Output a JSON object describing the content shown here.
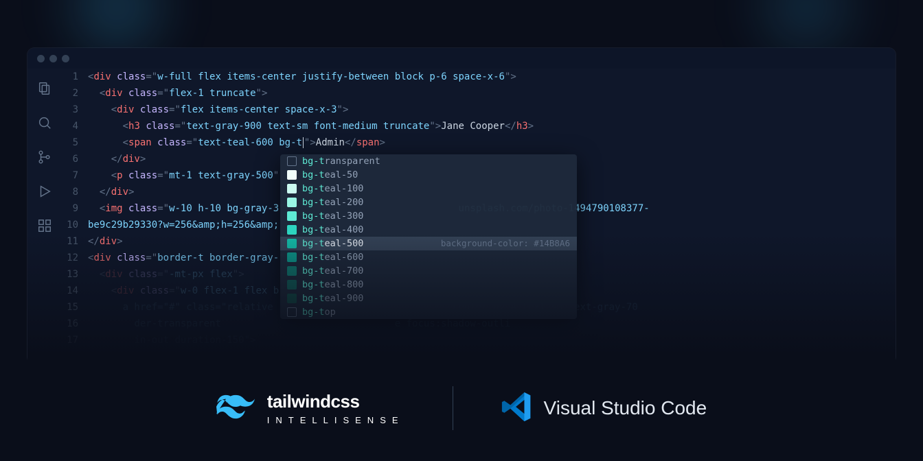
{
  "code": {
    "lines": [
      {
        "num": 1,
        "indent": 0,
        "tag": "div",
        "classAttr": "w-full flex items-center justify-between block p-6 space-x-6",
        "open": true
      },
      {
        "num": 2,
        "indent": 1,
        "tag": "div",
        "classAttr": "flex-1 truncate",
        "open": true
      },
      {
        "num": 3,
        "indent": 2,
        "tag": "div",
        "classAttr": "flex items-center space-x-3",
        "open": true
      },
      {
        "num": 4,
        "indent": 3,
        "tag": "h3",
        "classAttr": "text-gray-900 text-sm font-medium truncate",
        "content": "Jane Cooper",
        "close": "h3"
      },
      {
        "num": 5,
        "indent": 3,
        "tag": "span",
        "classAttr": "text-teal-600 bg-t",
        "cursor": true,
        "content": "Admin",
        "close": "span"
      },
      {
        "num": 6,
        "indent": 2,
        "closeTag": "div"
      },
      {
        "num": 7,
        "indent": 2,
        "tag": "p",
        "classAttr": "mt-1 text-gray-500",
        "open": true,
        "truncated": true
      },
      {
        "num": 8,
        "indent": 1,
        "closeTag": "div"
      },
      {
        "num": 9,
        "indent": 1,
        "tag": "img",
        "classAttr": "w-10 h-10 bg-gray-3",
        "truncated": true,
        "tail": "unsplash.com/photo-1494790108377-"
      },
      {
        "num": 10,
        "indent": 0,
        "raw": "be9c29b29330?w=256&amp;h=256&amp;"
      },
      {
        "num": 11,
        "indent": 0,
        "closeTag": "div"
      },
      {
        "num": 12,
        "indent": 0,
        "tag": "div",
        "classAttr": "border-t border-gray-",
        "open": true,
        "truncated": true
      },
      {
        "num": 13,
        "indent": 1,
        "tag": "div",
        "classAttr": "-mt-px flex",
        "open": true,
        "fade": 1
      },
      {
        "num": 14,
        "indent": 2,
        "tag": "div",
        "classAttr": "w-0 flex-1 flex b",
        "open": true,
        "truncated": true,
        "fade": 1
      },
      {
        "num": 15,
        "indent": 3,
        "fade": 2,
        "rawHtml": "a href=\"#\" class=\"relative",
        "tail": "-center py-4 text-sm text-gray-70"
      },
      {
        "num": 16,
        "indent": 4,
        "fade": 2,
        "rawHtml": "der-transparent",
        "tail": "e focus:shadow-outli"
      },
      {
        "num": 17,
        "indent": 4,
        "fade": 2,
        "rawHtml": "in-out duration-150\">"
      }
    ]
  },
  "autocomplete": {
    "items": [
      {
        "label": "bg-transparent",
        "match": "bg-t",
        "rest": "ransparent",
        "icon": "abc"
      },
      {
        "label": "bg-teal-50",
        "match": "bg-t",
        "rest": "eal-50",
        "swatch": "#f0fdfa"
      },
      {
        "label": "bg-teal-100",
        "match": "bg-t",
        "rest": "eal-100",
        "swatch": "#ccfbf1"
      },
      {
        "label": "bg-teal-200",
        "match": "bg-t",
        "rest": "eal-200",
        "swatch": "#99f6e4"
      },
      {
        "label": "bg-teal-300",
        "match": "bg-t",
        "rest": "eal-300",
        "swatch": "#5eead4"
      },
      {
        "label": "bg-teal-400",
        "match": "bg-t",
        "rest": "eal-400",
        "swatch": "#2dd4bf"
      },
      {
        "label": "bg-teal-500",
        "match": "bg-t",
        "rest": "eal-500",
        "swatch": "#14b8a6",
        "selected": true,
        "hint": "background-color: #14B8A6"
      },
      {
        "label": "bg-teal-600",
        "match": "bg-t",
        "rest": "eal-600",
        "swatch": "#0d9488"
      },
      {
        "label": "bg-teal-700",
        "match": "bg-t",
        "rest": "eal-700",
        "swatch": "#0f766e"
      },
      {
        "label": "bg-teal-800",
        "match": "bg-t",
        "rest": "eal-800",
        "swatch": "#115e59"
      },
      {
        "label": "bg-teal-900",
        "match": "bg-t",
        "rest": "eal-900",
        "swatch": "#134e4a"
      },
      {
        "label": "bg-top",
        "match": "bg-t",
        "rest": "op",
        "icon": "abc"
      }
    ]
  },
  "branding": {
    "tailwind_main": "tailwindcss",
    "tailwind_sub": "INTELLISENSE",
    "vscode": "Visual Studio Code"
  }
}
